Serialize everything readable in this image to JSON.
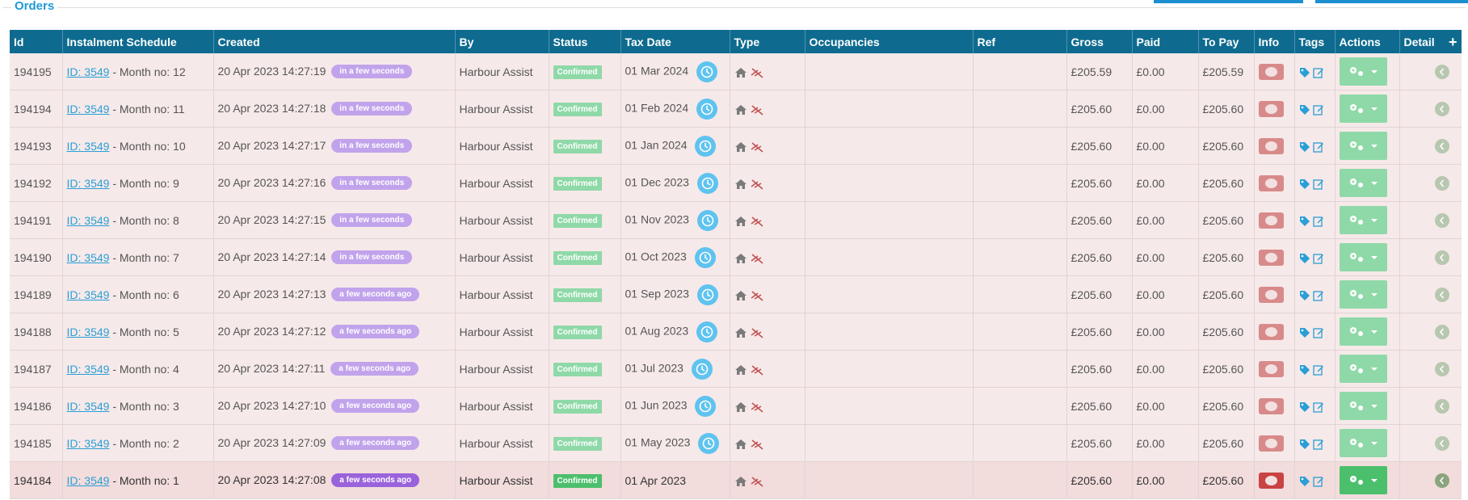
{
  "section": {
    "title": "Orders"
  },
  "columns": [
    "Id",
    "Instalment Schedule",
    "Created",
    "By",
    "Status",
    "Tax Date",
    "Type",
    "Occupancies",
    "Ref",
    "Gross",
    "Paid",
    "To Pay",
    "Info",
    "Tags",
    "Actions",
    "Detail"
  ],
  "add_icon": "+",
  "colors": {
    "header": "#0e6b8f",
    "row": "#f6e9e9",
    "status": "#4cbf6d",
    "pill": "#9a63db",
    "clock": "#5fc3f0",
    "info": "#c94343",
    "link": "#2a9fd6"
  },
  "rows": [
    {
      "id": "194195",
      "schedule_link": "ID: 3549",
      "schedule_month": "Month no: 12",
      "created": "20 Apr 2023 14:27:19",
      "relative": "in a few seconds",
      "by": "Harbour Assist",
      "status": "Confirmed",
      "tax_date": "01 Mar 2024",
      "has_clock": true,
      "occupancies": "",
      "ref": "",
      "gross": "£205.59",
      "paid": "£0.00",
      "to_pay": "£205.59"
    },
    {
      "id": "194194",
      "schedule_link": "ID: 3549",
      "schedule_month": "Month no: 11",
      "created": "20 Apr 2023 14:27:18",
      "relative": "in a few seconds",
      "by": "Harbour Assist",
      "status": "Confirmed",
      "tax_date": "01 Feb 2024",
      "has_clock": true,
      "occupancies": "",
      "ref": "",
      "gross": "£205.60",
      "paid": "£0.00",
      "to_pay": "£205.60"
    },
    {
      "id": "194193",
      "schedule_link": "ID: 3549",
      "schedule_month": "Month no: 10",
      "created": "20 Apr 2023 14:27:17",
      "relative": "in a few seconds",
      "by": "Harbour Assist",
      "status": "Confirmed",
      "tax_date": "01 Jan 2024",
      "has_clock": true,
      "occupancies": "",
      "ref": "",
      "gross": "£205.60",
      "paid": "£0.00",
      "to_pay": "£205.60"
    },
    {
      "id": "194192",
      "schedule_link": "ID: 3549",
      "schedule_month": "Month no: 9",
      "created": "20 Apr 2023 14:27:16",
      "relative": "in a few seconds",
      "by": "Harbour Assist",
      "status": "Confirmed",
      "tax_date": "01 Dec 2023",
      "has_clock": true,
      "occupancies": "",
      "ref": "",
      "gross": "£205.60",
      "paid": "£0.00",
      "to_pay": "£205.60"
    },
    {
      "id": "194191",
      "schedule_link": "ID: 3549",
      "schedule_month": "Month no: 8",
      "created": "20 Apr 2023 14:27:15",
      "relative": "in a few seconds",
      "by": "Harbour Assist",
      "status": "Confirmed",
      "tax_date": "01 Nov 2023",
      "has_clock": true,
      "occupancies": "",
      "ref": "",
      "gross": "£205.60",
      "paid": "£0.00",
      "to_pay": "£205.60"
    },
    {
      "id": "194190",
      "schedule_link": "ID: 3549",
      "schedule_month": "Month no: 7",
      "created": "20 Apr 2023 14:27:14",
      "relative": "in a few seconds",
      "by": "Harbour Assist",
      "status": "Confirmed",
      "tax_date": "01 Oct 2023",
      "has_clock": true,
      "occupancies": "",
      "ref": "",
      "gross": "£205.60",
      "paid": "£0.00",
      "to_pay": "£205.60"
    },
    {
      "id": "194189",
      "schedule_link": "ID: 3549",
      "schedule_month": "Month no: 6",
      "created": "20 Apr 2023 14:27:13",
      "relative": "a few seconds ago",
      "by": "Harbour Assist",
      "status": "Confirmed",
      "tax_date": "01 Sep 2023",
      "has_clock": true,
      "occupancies": "",
      "ref": "",
      "gross": "£205.60",
      "paid": "£0.00",
      "to_pay": "£205.60"
    },
    {
      "id": "194188",
      "schedule_link": "ID: 3549",
      "schedule_month": "Month no: 5",
      "created": "20 Apr 2023 14:27:12",
      "relative": "a few seconds ago",
      "by": "Harbour Assist",
      "status": "Confirmed",
      "tax_date": "01 Aug 2023",
      "has_clock": true,
      "occupancies": "",
      "ref": "",
      "gross": "£205.60",
      "paid": "£0.00",
      "to_pay": "£205.60"
    },
    {
      "id": "194187",
      "schedule_link": "ID: 3549",
      "schedule_month": "Month no: 4",
      "created": "20 Apr 2023 14:27:11",
      "relative": "a few seconds ago",
      "by": "Harbour Assist",
      "status": "Confirmed",
      "tax_date": "01 Jul 2023",
      "has_clock": true,
      "occupancies": "",
      "ref": "",
      "gross": "£205.60",
      "paid": "£0.00",
      "to_pay": "£205.60"
    },
    {
      "id": "194186",
      "schedule_link": "ID: 3549",
      "schedule_month": "Month no: 3",
      "created": "20 Apr 2023 14:27:10",
      "relative": "a few seconds ago",
      "by": "Harbour Assist",
      "status": "Confirmed",
      "tax_date": "01 Jun 2023",
      "has_clock": true,
      "occupancies": "",
      "ref": "",
      "gross": "£205.60",
      "paid": "£0.00",
      "to_pay": "£205.60"
    },
    {
      "id": "194185",
      "schedule_link": "ID: 3549",
      "schedule_month": "Month no: 2",
      "created": "20 Apr 2023 14:27:09",
      "relative": "a few seconds ago",
      "by": "Harbour Assist",
      "status": "Confirmed",
      "tax_date": "01 May 2023",
      "has_clock": true,
      "occupancies": "",
      "ref": "",
      "gross": "£205.60",
      "paid": "£0.00",
      "to_pay": "£205.60"
    },
    {
      "id": "194184",
      "schedule_link": "ID: 3549",
      "schedule_month": "Month no: 1",
      "created": "20 Apr 2023 14:27:08",
      "relative": "a few seconds ago",
      "by": "Harbour Assist",
      "status": "Confirmed",
      "tax_date": "01 Apr 2023",
      "has_clock": false,
      "occupancies": "",
      "ref": "",
      "gross": "£205.60",
      "paid": "£0.00",
      "to_pay": "£205.60"
    }
  ]
}
